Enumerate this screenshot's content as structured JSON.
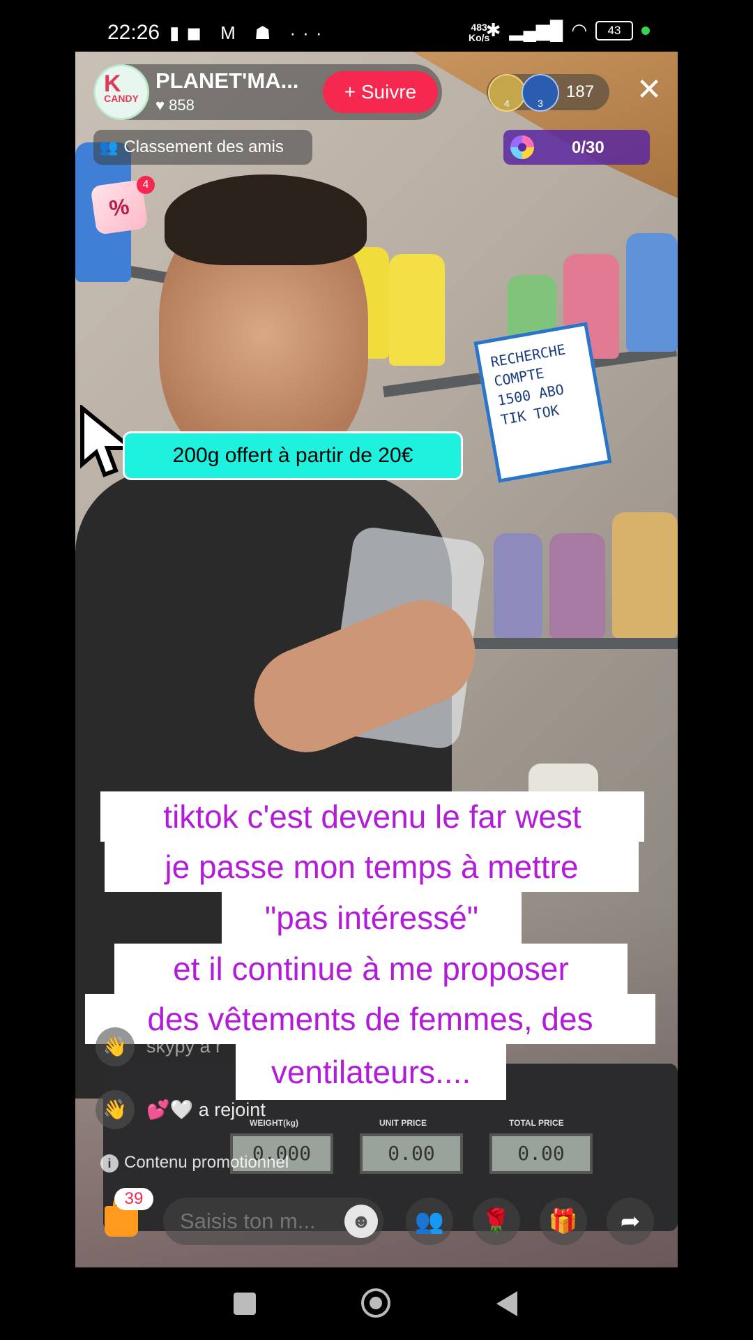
{
  "status_bar": {
    "time": "22:26",
    "left_icons": "▮◼ M ☗ ···",
    "net_speed_value": "483",
    "net_speed_unit": "Ko/s",
    "battery": "43"
  },
  "live": {
    "host_name": "PLANET'MA...",
    "host_likes": "♥ 858",
    "avatar_brand": "CANDY",
    "avatar_letter": "K",
    "follow_label": "+ Suivre",
    "viewer_badge_1": "4",
    "viewer_badge_2": "3",
    "viewer_count": "187",
    "close_icon": "✕",
    "friends_ranking": "Classement des amis",
    "goal_progress": "0/30",
    "coupon_symbol": "%",
    "coupon_count": "4"
  },
  "video": {
    "sign_text": "RECHERCHE COMPTE 1500 ABO TIK TOK",
    "scale_labels": [
      "WEIGHT(kg)",
      "UNIT PRICE",
      "TOTAL PRICE"
    ],
    "scale_values": [
      "0.000",
      "0.00",
      "0.00"
    ]
  },
  "promo_banner": "200g offert à partir de 20€",
  "caption_lines": [
    "tiktok c'est devenu le far west",
    "je passe mon temps à mettre",
    "\"pas intéressé\"",
    "et il continue à me proposer",
    "des vêtements de femmes, des",
    "ventilateurs...."
  ],
  "chat": {
    "join_1": "skypy a r",
    "join_2": "a rejoint",
    "promo_note": "Contenu promotionnel",
    "info_icon": "i"
  },
  "bottom_bar": {
    "shop_count": "39",
    "input_placeholder": "Saisis ton m...",
    "emoji_icon": "☻",
    "buttons": [
      "👥",
      "🌹",
      "🎁",
      "➦"
    ]
  },
  "colors": {
    "follow": "#f7284f",
    "promo_banner": "#1ef2df",
    "caption_text": "#b21cd9",
    "goal_bg": "#5a28a0"
  }
}
